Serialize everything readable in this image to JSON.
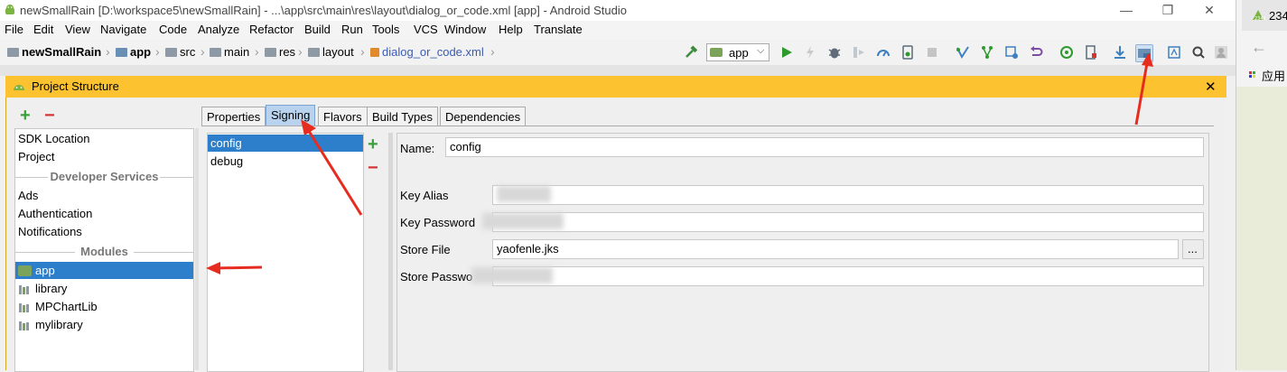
{
  "window": {
    "title": "newSmallRain [D:\\workspace5\\newSmallRain] - ...\\app\\src\\main\\res\\layout\\dialog_or_code.xml [app] - Android Studio",
    "minimize": "—",
    "maximize": "❐",
    "close": "✕"
  },
  "menu": [
    "File",
    "Edit",
    "View",
    "Navigate",
    "Code",
    "Analyze",
    "Refactor",
    "Build",
    "Run",
    "Tools",
    "VCS",
    "Window",
    "Help",
    "Translate"
  ],
  "breadcrumb": [
    "newSmallRain",
    "app",
    "src",
    "main",
    "res",
    "layout",
    "dialog_or_code.xml"
  ],
  "toolbar": {
    "run_config": "app"
  },
  "side": {
    "text1": "234",
    "text2": "应用"
  },
  "dialog": {
    "title": "Project Structure",
    "close": "✕",
    "add": "+",
    "remove": "−",
    "left_items": {
      "sdk": "SDK Location",
      "project": "Project",
      "dev_header": "Developer Services",
      "ads": "Ads",
      "auth": "Authentication",
      "notif": "Notifications",
      "modules_header": "Modules",
      "modules": [
        "app",
        "library",
        "MPChartLib",
        "mylibrary"
      ]
    },
    "tabs": [
      "Properties",
      "Signing",
      "Flavors",
      "Build Types",
      "Dependencies"
    ],
    "configs": [
      "config",
      "debug"
    ],
    "form": {
      "name_label": "Name:",
      "name_value": "config",
      "key_alias_label": "Key Alias",
      "key_password_label": "Key Password",
      "store_file_label": "Store File",
      "store_file_value": "yaofenle.jks",
      "browse": "...",
      "store_password_label": "Store Passwo"
    }
  },
  "colors": {
    "accent": "#2d7fcb",
    "dialog_title": "#fcc230",
    "arrow": "#e62c1f",
    "add_green": "#3aa03a",
    "remove_red": "#d33333"
  }
}
